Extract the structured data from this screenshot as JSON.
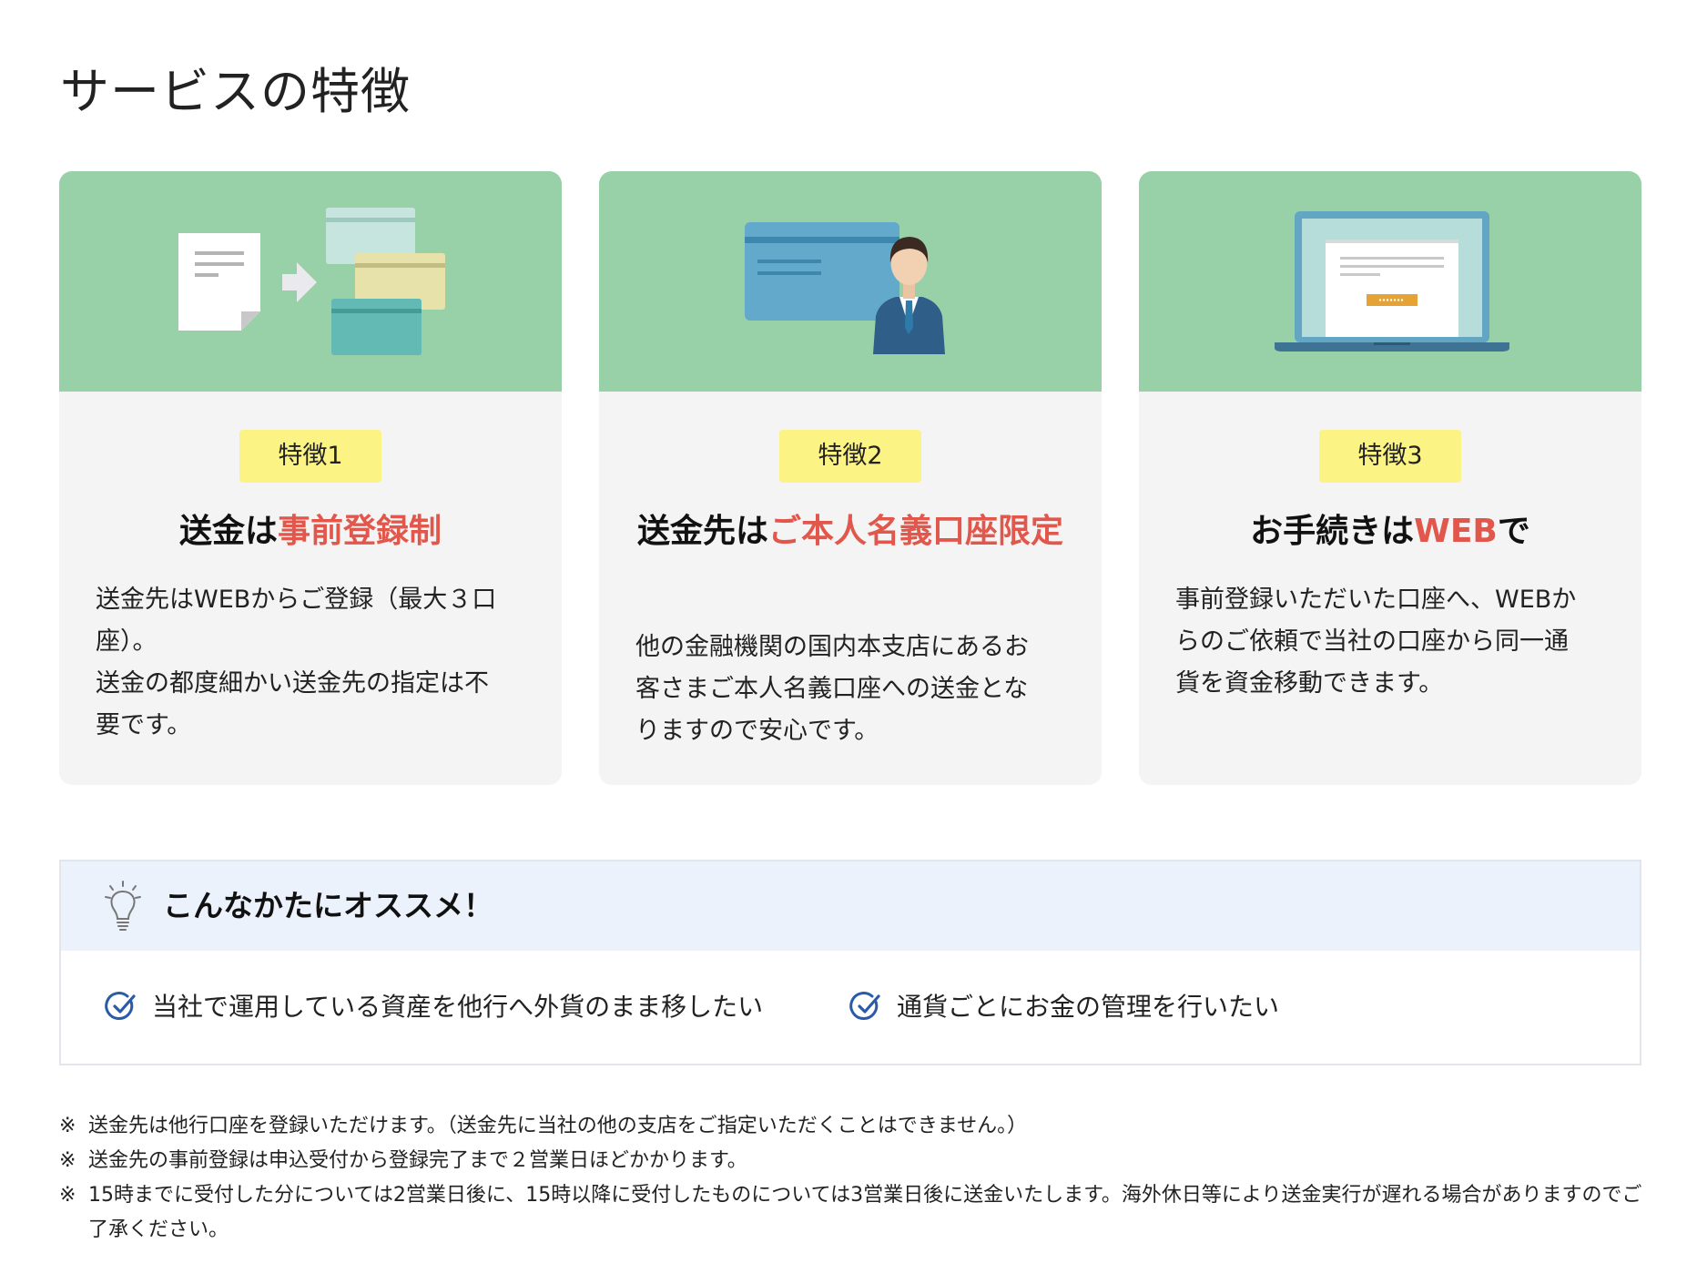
{
  "page": {
    "title": "サービスの特徴"
  },
  "features": [
    {
      "badge": "特徴1",
      "title_prefix": "送金は",
      "title_highlight": "事前登録制",
      "title_suffix": "",
      "body": "送金先はWEBからご登録（最大３口\n座）。\n送金の都度細かい送金先の指定は不\n要です。"
    },
    {
      "badge": "特徴2",
      "title_prefix": "送金先は",
      "title_highlight": "ご本人名義口座限定",
      "title_suffix": "",
      "body": "他の金融機関の国内本支店にあるお\n客さまご本人名義口座への送金とな\nりますので安心です。"
    },
    {
      "badge": "特徴3",
      "title_prefix": "お手続きは",
      "title_highlight": "WEB",
      "title_suffix": "で",
      "body": "事前登録いただいた口座へ、WEBか\nらのご依頼で当社の口座から同一通\n貨を資金移動できます。"
    }
  ],
  "recommend": {
    "title": "こんなかたにオススメ！",
    "items": [
      "当社で運用している資産を他行へ外貨のまま移したい",
      "通貨ごとにお金の管理を行いたい"
    ]
  },
  "notes": [
    {
      "mark": "※",
      "text": "送金先は他行口座を登録いただけます。（送金先に当社の他の支店をご指定いただくことはできません。）"
    },
    {
      "mark": "※",
      "text": "送金先の事前登録は申込受付から登録完了まで２営業日ほどかかります。"
    },
    {
      "mark": "※",
      "text": "15時までに受付した分については2営業日後に、15時以降に受付したものについては3営業日後に送金いたします。海外休日等により送金実行が遅れる場合がありますのでご了承ください。"
    }
  ],
  "colors": {
    "hero_green": "#98d1a7",
    "badge_yellow": "#fbf383",
    "highlight_red": "#e2574c",
    "recommend_header": "#ebf2fc",
    "check_blue": "#2a5aa8"
  },
  "icons": {
    "feature1": "documents-to-cards-illustration",
    "feature2": "bank-card-with-person-illustration",
    "feature3": "laptop-with-web-form-illustration",
    "recommend": "lightbulb-icon",
    "item": "check-circle-icon"
  }
}
